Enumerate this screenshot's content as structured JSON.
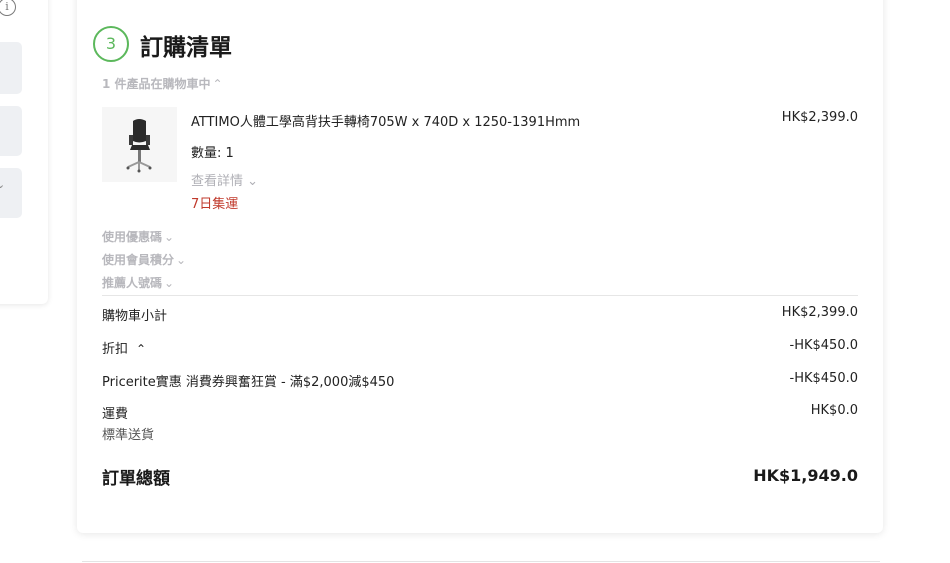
{
  "left_panel": {
    "info_icon": "info-icon",
    "chevron_icon": "chevron-down-icon"
  },
  "order": {
    "step_number": "3",
    "title": "訂購清單",
    "cart_count_text": "1 件產品在購物車中",
    "items": [
      {
        "name": "ATTIMO人體工學高背扶手轉椅705W x 740D x 1250-1391Hmm",
        "quantity_text": "數量: 1",
        "view_details": "查看詳情",
        "delivery": "7日集運",
        "price": "HK$2,399.0"
      }
    ],
    "options": {
      "coupon": "使用優惠碼",
      "member_points": "使用會員積分",
      "referral": "推薦人號碼"
    },
    "summary": {
      "subtotal_label": "購物車小計",
      "subtotal_value": "HK$2,399.0",
      "discount_label": "折扣",
      "discount_value": "-HK$450.0",
      "promo_label": "Pricerite實惠 消費券興奮狂賞 - 滿$2,000減$450",
      "promo_value": "-HK$450.0",
      "shipping_label": "運費",
      "shipping_method": "標準送貨",
      "shipping_value": "HK$0.0",
      "total_label": "訂單總額",
      "total_value": "HK$1,949.0"
    }
  },
  "colors": {
    "step_accent": "#5cb85c",
    "delivery_red": "#c0392b",
    "muted": "#b8b8bd"
  }
}
